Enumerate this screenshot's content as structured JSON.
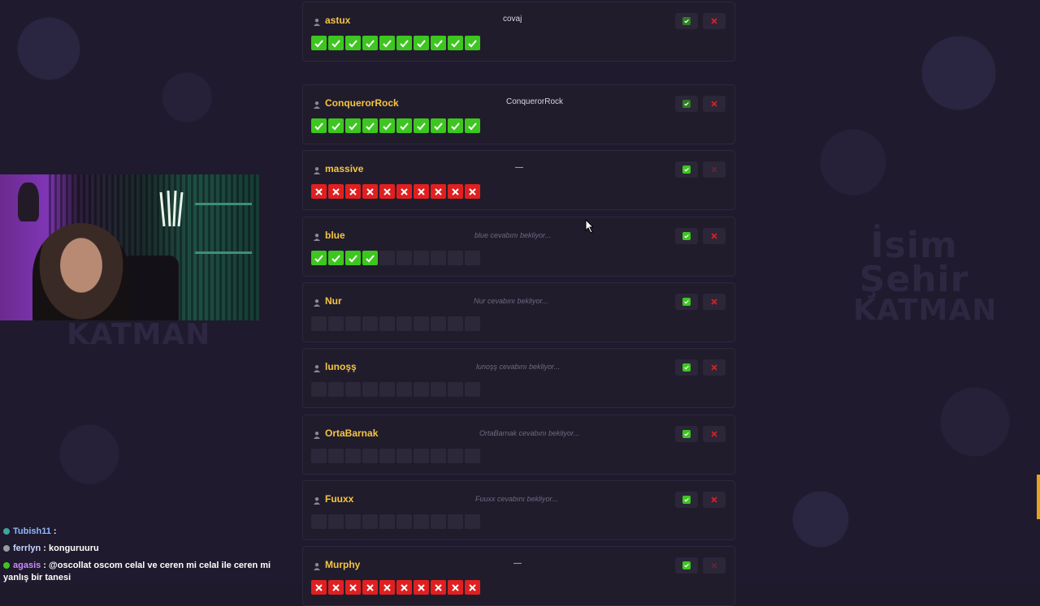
{
  "watermarks": {
    "left": "KATMAN",
    "right_line1": "İsim",
    "right_line2": "Şehir",
    "right_line3": "KATMAN"
  },
  "colors": {
    "username": "#f5c542",
    "correct": "#3ec620",
    "wrong": "#e02020",
    "empty": "#2c2839",
    "scroll_indicator": "#e8a31b"
  },
  "players": [
    {
      "name": "astux",
      "answer": "covaj",
      "answer_state": "given",
      "results": [
        "ok",
        "ok",
        "ok",
        "ok",
        "ok",
        "ok",
        "ok",
        "ok",
        "ok",
        "ok"
      ],
      "accept_dim": true
    },
    {
      "name": "ConquerorRock",
      "answer": "ConquerorRock",
      "answer_state": "given",
      "results": [
        "ok",
        "ok",
        "ok",
        "ok",
        "ok",
        "ok",
        "ok",
        "ok",
        "ok",
        "ok"
      ],
      "accept_dim": true
    },
    {
      "name": "massive",
      "answer": "—",
      "answer_state": "given",
      "results": [
        "no",
        "no",
        "no",
        "no",
        "no",
        "no",
        "no",
        "no",
        "no",
        "no"
      ],
      "accept_dim": false
    },
    {
      "name": "blue",
      "answer": "blue cevabını bekliyor...",
      "answer_state": "waiting",
      "results": [
        "ok",
        "ok",
        "ok",
        "ok",
        "",
        "",
        "",
        "",
        "",
        ""
      ],
      "accept_dim": false
    },
    {
      "name": "Nur",
      "answer": "Nur cevabını bekliyor...",
      "answer_state": "waiting",
      "results": [
        "",
        "",
        "",
        "",
        "",
        "",
        "",
        "",
        "",
        ""
      ],
      "accept_dim": false
    },
    {
      "name": "lunoşş",
      "answer": "lunoşş cevabını bekliyor...",
      "answer_state": "waiting",
      "results": [
        "",
        "",
        "",
        "",
        "",
        "",
        "",
        "",
        "",
        ""
      ],
      "accept_dim": false
    },
    {
      "name": "OrtaBarnak",
      "answer": "OrtaBarnak cevabını bekliyor...",
      "answer_state": "waiting",
      "results": [
        "",
        "",
        "",
        "",
        "",
        "",
        "",
        "",
        "",
        ""
      ],
      "accept_dim": false
    },
    {
      "name": "Fuuxx",
      "answer": "Fuuxx cevabını bekliyor...",
      "answer_state": "waiting",
      "results": [
        "",
        "",
        "",
        "",
        "",
        "",
        "",
        "",
        "",
        ""
      ],
      "accept_dim": false
    },
    {
      "name": "Murphy",
      "answer": "—",
      "answer_state": "given",
      "results": [
        "no",
        "no",
        "no",
        "no",
        "no",
        "no",
        "no",
        "no",
        "no",
        "no"
      ],
      "accept_dim": false
    }
  ],
  "chat": [
    {
      "user": "Tubish11",
      "message": ""
    },
    {
      "user": "ferrlyn",
      "message": "konguruuru"
    },
    {
      "user": "agasis",
      "message": "@oscollat oscom celal ve ceren mi celal ile ceren mi yanlış bir tanesi"
    }
  ]
}
